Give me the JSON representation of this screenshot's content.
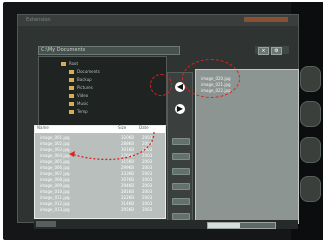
{
  "window": {
    "title": "Extension"
  },
  "path_bar": {
    "current_path": "C:\\My Documents"
  },
  "toolbar": {
    "icons": [
      "close-icon",
      "settings-icon"
    ]
  },
  "tree": {
    "items": [
      {
        "label": "Root",
        "icon": "folder-icon"
      },
      {
        "label": "Documents",
        "icon": "folder-icon"
      },
      {
        "label": "Backup",
        "icon": "folder-icon"
      },
      {
        "label": "Pictures",
        "icon": "folder-icon"
      },
      {
        "label": "Video",
        "icon": "folder-icon"
      },
      {
        "label": "Music",
        "icon": "folder-icon"
      },
      {
        "label": "Temp",
        "icon": "folder-icon"
      }
    ]
  },
  "left_list": {
    "columns": [
      "Name",
      "Size",
      "Date"
    ],
    "rows": [
      {
        "name": "image_001.jpg",
        "size": "320KB",
        "date": "2003"
      },
      {
        "name": "image_002.jpg",
        "size": "288KB",
        "date": "2003"
      },
      {
        "name": "image_003.jpg",
        "size": "301KB",
        "date": "2003"
      },
      {
        "name": "image_004.jpg",
        "size": "276KB",
        "date": "2003"
      },
      {
        "name": "image_005.jpg",
        "size": "315KB",
        "date": "2003"
      },
      {
        "name": "image_006.jpg",
        "size": "299KB",
        "date": "2003"
      },
      {
        "name": "image_007.jpg",
        "size": "333KB",
        "date": "2003"
      },
      {
        "name": "image_008.jpg",
        "size": "307KB",
        "date": "2003"
      },
      {
        "name": "image_009.jpg",
        "size": "294KB",
        "date": "2003"
      },
      {
        "name": "image_010.jpg",
        "size": "281KB",
        "date": "2003"
      },
      {
        "name": "image_011.jpg",
        "size": "322KB",
        "date": "2003"
      },
      {
        "name": "image_012.jpg",
        "size": "314KB",
        "date": "2003"
      },
      {
        "name": "image_013.jpg",
        "size": "295KB",
        "date": "2003"
      }
    ]
  },
  "center_controls": {
    "buttons": [
      {
        "icon": "arrow-left-icon",
        "glyph": "◀"
      },
      {
        "icon": "arrow-right-icon",
        "glyph": "▶"
      }
    ]
  },
  "right_panel": {
    "items": [
      {
        "label": "image_020.jpg"
      },
      {
        "label": "image_021.jpg"
      },
      {
        "label": "image_022.jpg"
      }
    ]
  },
  "status": {
    "progress": 0.48
  },
  "accent_colors": {
    "callout": "#e32020",
    "folder": "#d4b052",
    "title_accent": "#a95a2e"
  }
}
